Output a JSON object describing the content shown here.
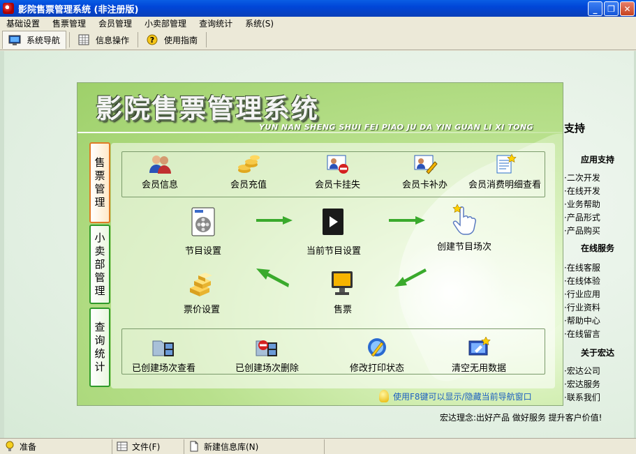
{
  "window": {
    "title": "影院售票管理系统 (非注册版)",
    "buttons": {
      "minimize": "_",
      "maximize": "❐",
      "close": "✕"
    }
  },
  "menu": [
    "基础设置",
    "售票管理",
    "会员管理",
    "小卖部管理",
    "查询统计",
    "系统(S)"
  ],
  "tabs": [
    "系统导航",
    "信息操作",
    "使用指南"
  ],
  "header": {
    "title": "影院售票管理系统",
    "subtitle": "YUN NAN SHENG SHUI FEI PIAO JU DA YIN GUAN LI XI TONG"
  },
  "side_tabs": [
    "售票管理",
    "小卖部管理",
    "查询统计"
  ],
  "member_items": [
    "会员信息",
    "会员充值",
    "会员卡挂失",
    "会员卡补办",
    "会员消费明细查看"
  ],
  "flow_items": [
    "节目设置",
    "当前节目设置",
    "创建节目场次",
    "票价设置",
    "售票"
  ],
  "query_items": [
    "已创建场次查看",
    "已创建场次删除",
    "修改打印状态",
    "清空无用数据"
  ],
  "tip": "使用F8键可以显示/隐藏当前导航窗口",
  "right": {
    "heading": "支持",
    "sections": [
      {
        "title": "应用支持",
        "links": [
          "二次开发",
          "在线开发",
          "业务帮助",
          "产品形式",
          "产品购买"
        ]
      },
      {
        "title": "在线服务",
        "links": [
          "在线客服",
          "在线体验",
          "行业应用",
          "行业资料",
          "帮助中心",
          "在线留言"
        ]
      },
      {
        "title": "关于宏达",
        "links": [
          "宏达公司",
          "宏达服务",
          "联系我们"
        ]
      }
    ]
  },
  "slogan": "宏达理念:出好产品 做好服务 提升客户价值!",
  "status": {
    "ready": "准备",
    "file": "文件(F)",
    "newdb": "新建信息库(N)"
  },
  "colors": {
    "titlebar": "#0a5de4",
    "panel_green": "#b8e08c",
    "tab_active_border": "#e07a25",
    "tab_border": "#2f9a2a",
    "arrow": "#3aaa2c",
    "tip": "#1c5fc1"
  }
}
